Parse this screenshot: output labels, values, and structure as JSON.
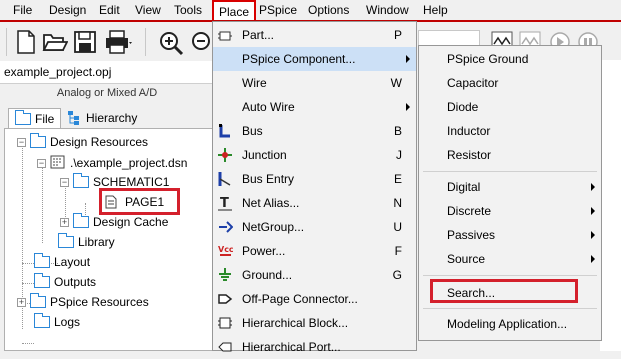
{
  "menubar": {
    "items": [
      "File",
      "Design",
      "Edit",
      "View",
      "Tools",
      "Place",
      "PSpice",
      "Options",
      "Window",
      "Help"
    ],
    "active": "Place",
    "accent_color": "#d80000"
  },
  "toolbar": {
    "icons": [
      "new-document-icon",
      "open-folder-icon",
      "save-icon",
      "print-icon",
      "zoom-in-icon",
      "zoom-out-icon"
    ]
  },
  "project": {
    "filename": "example_project.opj",
    "type_label": "Analog or Mixed A/D",
    "tabs": [
      "File",
      "Hierarchy"
    ],
    "tree": {
      "design_resources": "Design Resources",
      "dsn": ".\\example_project.dsn",
      "schematic": "SCHEMATIC1",
      "page": "PAGE1",
      "design_cache": "Design Cache",
      "library": "Library",
      "layout": "Layout",
      "outputs": "Outputs",
      "pspice_resources": "PSpice Resources",
      "logs": "Logs"
    }
  },
  "place_menu": {
    "items": [
      {
        "label": "Part...",
        "key": "P"
      },
      {
        "label": "PSpice Component...",
        "key": "",
        "submenu": true
      },
      {
        "label": "Wire",
        "key": "W"
      },
      {
        "label": "Auto Wire",
        "key": "",
        "submenu": true
      },
      {
        "label": "Bus",
        "key": "B"
      },
      {
        "label": "Junction",
        "key": "J"
      },
      {
        "label": "Bus Entry",
        "key": "E"
      },
      {
        "label": "Net Alias...",
        "key": "N"
      },
      {
        "label": "NetGroup...",
        "key": "U"
      },
      {
        "label": "Power...",
        "key": "F"
      },
      {
        "label": "Ground...",
        "key": "G"
      },
      {
        "label": "Off-Page Connector...",
        "key": ""
      },
      {
        "label": "Hierarchical Block...",
        "key": ""
      },
      {
        "label": "Hierarchical Port...",
        "key": ""
      }
    ],
    "highlight_color": "#cce0f6"
  },
  "pspice_submenu": {
    "group1": [
      "PSpice Ground",
      "Capacitor",
      "Diode",
      "Inductor",
      "Resistor"
    ],
    "group2": [
      "Digital",
      "Discrete",
      "Passives",
      "Source"
    ],
    "search": "Search...",
    "modeling": "Modeling Application..."
  }
}
